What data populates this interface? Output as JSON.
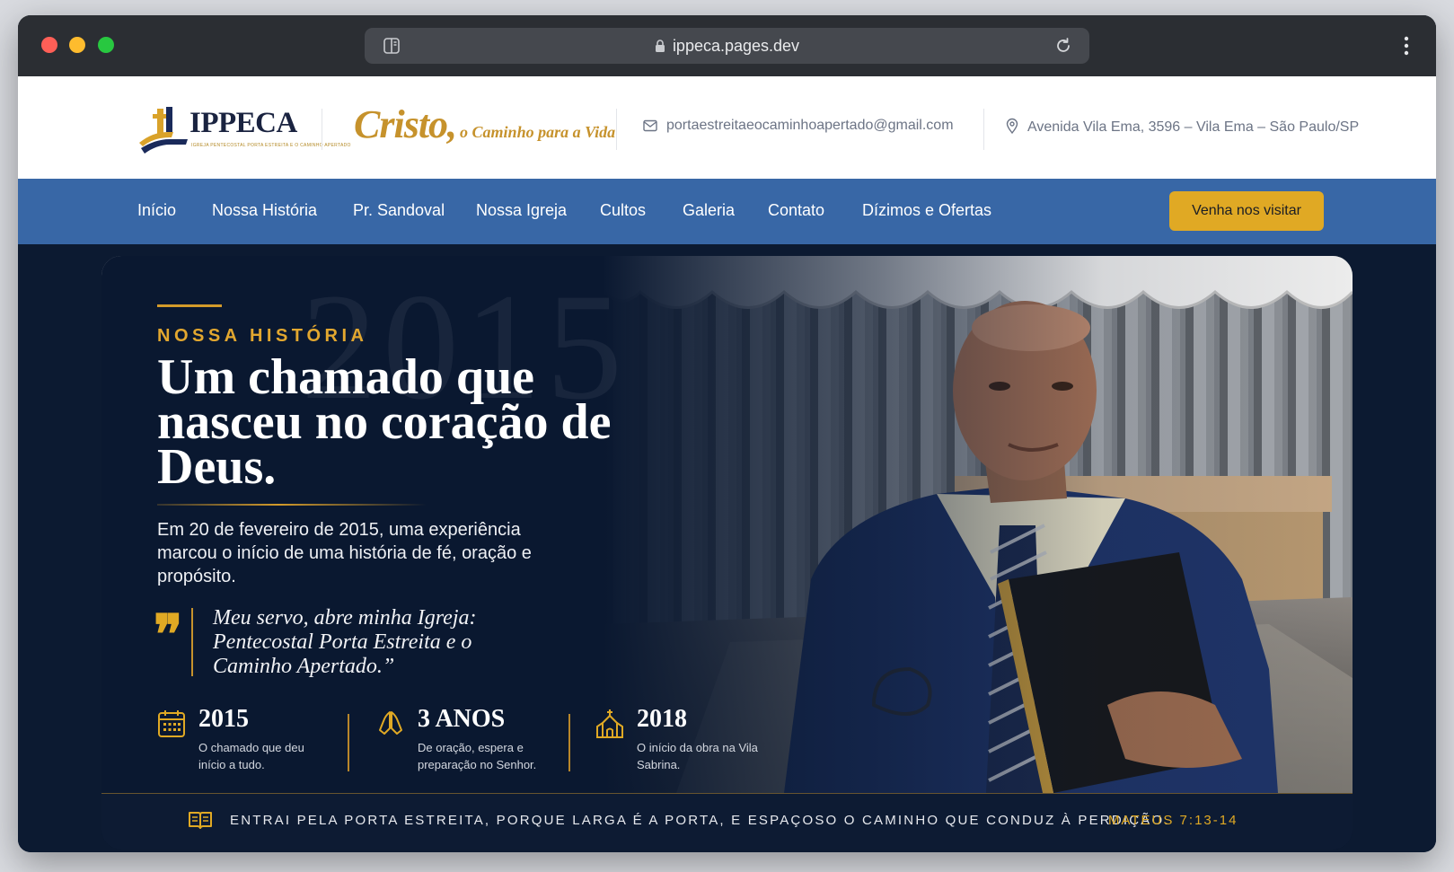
{
  "browser": {
    "url": "ippeca.pages.dev"
  },
  "header": {
    "logo_name": "IPPECA",
    "logo_tagline": "IGREJA PENTECOSTAL PORTA ESTREITA E O CAMINHO APERTADO",
    "slogan_main": "Cristo,",
    "slogan_rest": "o Caminho para a Vida",
    "email": "portaestreitaeocaminhoapertado@gmail.com",
    "address": "Avenida Vila Ema, 3596 – Vila Ema – São Paulo/SP"
  },
  "nav": {
    "items": [
      "Início",
      "Nossa História",
      "Pr. Sandoval",
      "Nossa Igreja",
      "Cultos",
      "Galeria",
      "Contato",
      "Dízimos e Ofertas"
    ],
    "cta": "Venha nos visitar"
  },
  "hero": {
    "watermark": "2015",
    "kicker": "NOSSA HISTÓRIA",
    "title": "Um chamado que nasceu no coração de Deus.",
    "description": "Em 20 de fevereiro de 2015, uma experiência marcou o início de uma história de fé, oração e propósito.",
    "quote": "Meu servo, abre minha Igreja: Pentecostal Porta Estreita e o Caminho Apertado.”",
    "stats": [
      {
        "value": "2015",
        "label": "O chamado que deu início a tudo.",
        "icon": "calendar-icon"
      },
      {
        "value": "3 ANOS",
        "label": "De oração, espera e preparação no Senhor.",
        "icon": "praying-hands-icon"
      },
      {
        "value": "2018",
        "label": "O início da obra na Vila Sabrina.",
        "icon": "church-icon"
      }
    ]
  },
  "verse": {
    "text": "ENTRAI PELA PORTA ESTREITA, PORQUE LARGA É A PORTA, E ESPAÇOSO O CAMINHO QUE CONDUZ À PERDIÇÃO.",
    "reference": "MATEUS 7:13-14"
  },
  "colors": {
    "nav_blue": "#3867a6",
    "gold": "#e0a924",
    "navy": "#0c1a31"
  }
}
